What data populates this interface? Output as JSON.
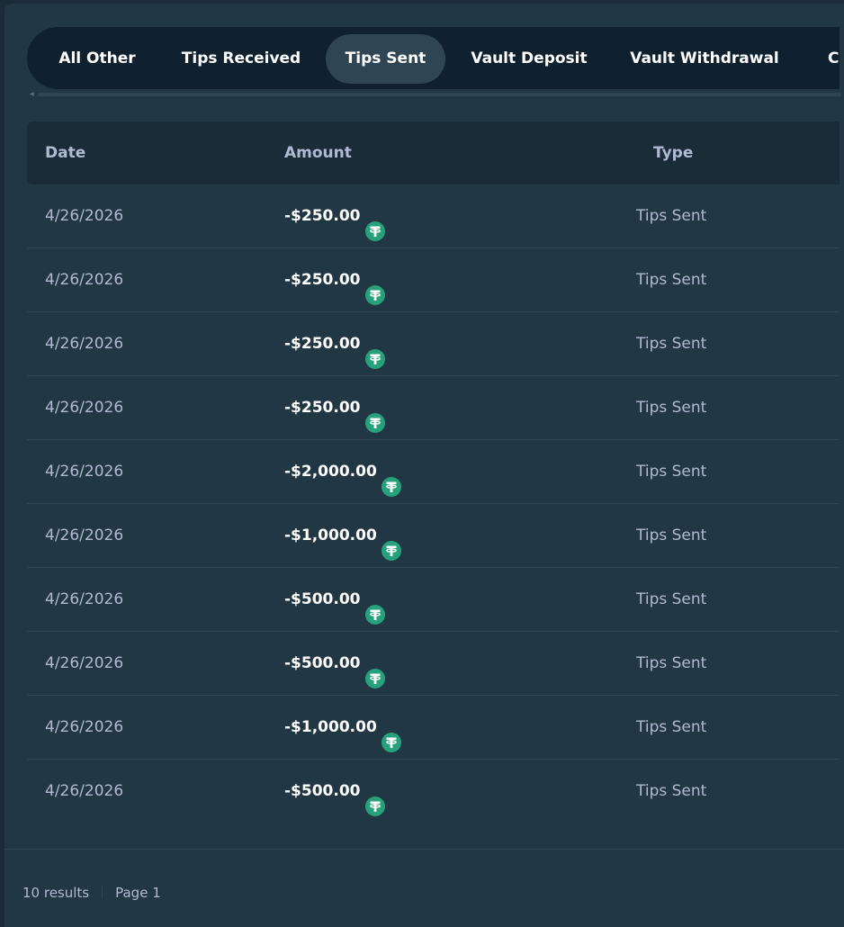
{
  "tabs": [
    {
      "label": "All Other",
      "active": false
    },
    {
      "label": "Tips Received",
      "active": false
    },
    {
      "label": "Tips Sent",
      "active": true
    },
    {
      "label": "Vault Deposit",
      "active": false
    },
    {
      "label": "Vault Withdrawal",
      "active": false
    },
    {
      "label": "Co",
      "active": false
    }
  ],
  "table": {
    "headers": {
      "date": "Date",
      "amount": "Amount",
      "type": "Type"
    },
    "rows": [
      {
        "date": "4/26/2026",
        "amount": "-$250.00",
        "currency_icon": "tether-icon",
        "type": "Tips Sent"
      },
      {
        "date": "4/26/2026",
        "amount": "-$250.00",
        "currency_icon": "tether-icon",
        "type": "Tips Sent"
      },
      {
        "date": "4/26/2026",
        "amount": "-$250.00",
        "currency_icon": "tether-icon",
        "type": "Tips Sent"
      },
      {
        "date": "4/26/2026",
        "amount": "-$250.00",
        "currency_icon": "tether-icon",
        "type": "Tips Sent"
      },
      {
        "date": "4/26/2026",
        "amount": "-$2,000.00",
        "currency_icon": "tether-icon",
        "type": "Tips Sent"
      },
      {
        "date": "4/26/2026",
        "amount": "-$1,000.00",
        "currency_icon": "tether-icon",
        "type": "Tips Sent"
      },
      {
        "date": "4/26/2026",
        "amount": "-$500.00",
        "currency_icon": "tether-icon",
        "type": "Tips Sent"
      },
      {
        "date": "4/26/2026",
        "amount": "-$500.00",
        "currency_icon": "tether-icon",
        "type": "Tips Sent"
      },
      {
        "date": "4/26/2026",
        "amount": "-$1,000.00",
        "currency_icon": "tether-icon",
        "type": "Tips Sent"
      },
      {
        "date": "4/26/2026",
        "amount": "-$500.00",
        "currency_icon": "tether-icon",
        "type": "Tips Sent"
      }
    ]
  },
  "footer": {
    "results": "10 results",
    "page": "Page 1"
  },
  "colors": {
    "background": "#1a2c38",
    "panel": "#213743",
    "tab_bar": "#0f212e",
    "tab_active": "#2f4553",
    "muted_text": "#b1bad3",
    "tether_green": "#26a17b"
  }
}
